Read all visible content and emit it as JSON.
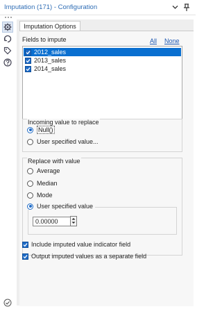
{
  "window": {
    "title": "Imputation (171) - Configuration",
    "chevron_icon": "chevron-down-icon",
    "pin_icon": "pin-icon",
    "accent_color": "#2f6db5"
  },
  "sidebar": {
    "icons": [
      "configuration-gear-icon",
      "annotation-icon",
      "tag-icon",
      "help-icon"
    ],
    "bottom_icon": "check-circle-icon"
  },
  "tabs": [
    {
      "label": "Imputation Options",
      "active": true
    }
  ],
  "fields": {
    "label": "Fields to impute",
    "all_link": "All",
    "none_link": "None",
    "items": [
      {
        "label": "2012_sales",
        "checked": true,
        "selected": true
      },
      {
        "label": "2013_sales",
        "checked": true,
        "selected": false
      },
      {
        "label": "2014_sales",
        "checked": true,
        "selected": false
      }
    ]
  },
  "incoming": {
    "title": "Incoming value to replace",
    "options": [
      {
        "label": "Null()",
        "selected": true
      },
      {
        "label": "User specified value...",
        "selected": false
      }
    ]
  },
  "replace": {
    "title": "Replace with value",
    "options": [
      {
        "label": "Average",
        "selected": false
      },
      {
        "label": "Median",
        "selected": false
      },
      {
        "label": "Mode",
        "selected": false
      },
      {
        "label": "User specified value",
        "selected": true
      }
    ],
    "user_value": "0.00000"
  },
  "checks": [
    {
      "label": "Include imputed value indicator field",
      "checked": true
    },
    {
      "label": "Output imputed values as a separate field",
      "checked": true
    }
  ]
}
